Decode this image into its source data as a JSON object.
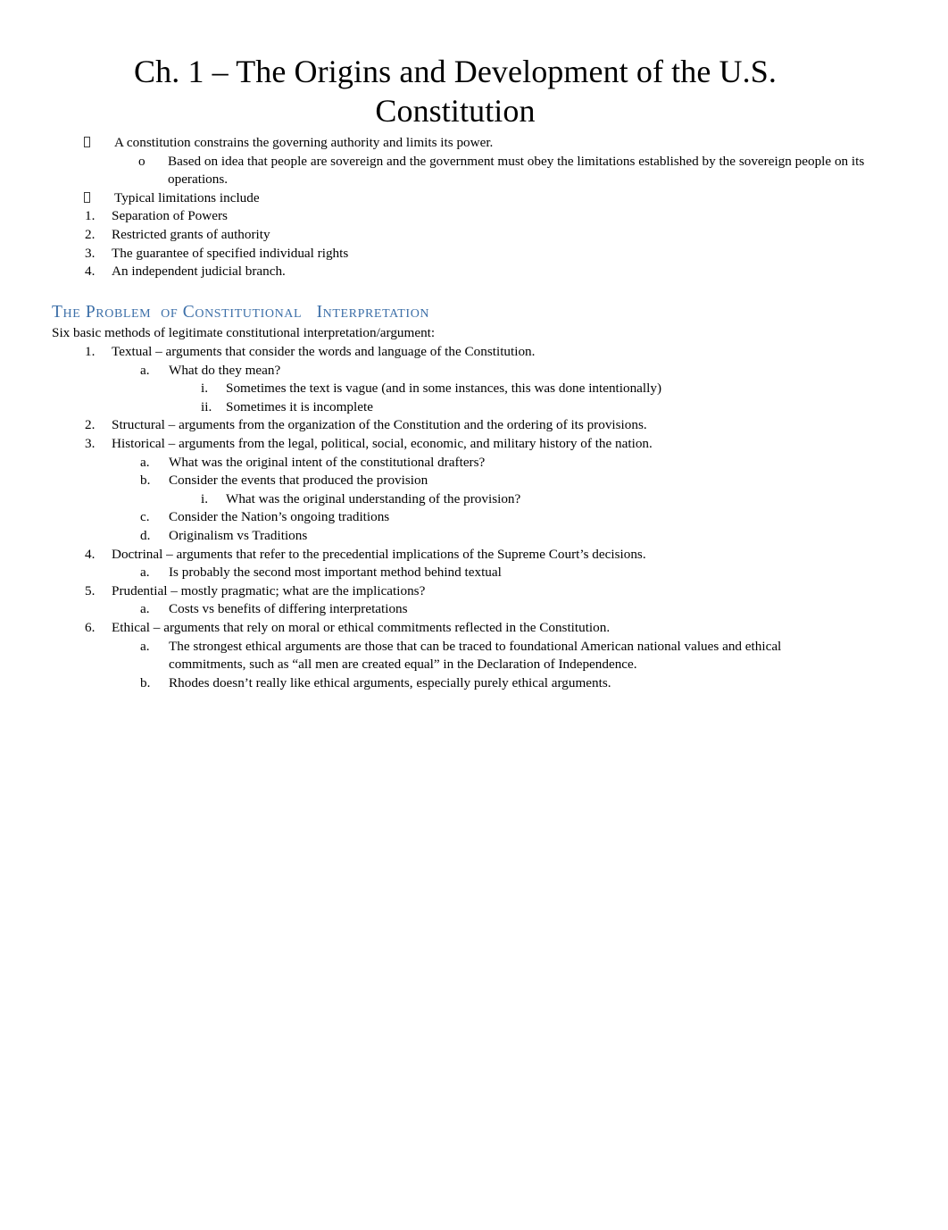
{
  "document": {
    "title_line_1": "Ch. 1 – The Origins and Development of the U.S.",
    "title_line_2": "Constitution"
  },
  "intro": {
    "items": [
      {
        "marker": "tofu",
        "level": "b1",
        "text": "A constitution constrains the governing authority and limits its power."
      },
      {
        "marker": "o",
        "level": "b2",
        "text": "Based on idea that people are sovereign and the government must obey the limitations established by the sovereign people on its operations."
      },
      {
        "marker": "tofu",
        "level": "b1",
        "text": "Typical limitations include"
      },
      {
        "marker": "1.",
        "level": "n1",
        "text": "Separation of Powers"
      },
      {
        "marker": "2.",
        "level": "n1",
        "text": "Restricted grants of authority"
      },
      {
        "marker": "3.",
        "level": "n1",
        "text": "The guarantee of specified individual rights"
      },
      {
        "marker": "4.",
        "level": "n1",
        "text": "An independent judicial branch."
      }
    ]
  },
  "section": {
    "heading": "The Problem  of Constitutional   Interpretation",
    "heading_color": "#3C6FA8",
    "lead": "Six basic methods of legitimate constitutional interpretation/argument:",
    "items": [
      {
        "marker": "1.",
        "level": "n1",
        "text": "Textual – arguments that consider the words and language of the Constitution."
      },
      {
        "marker": "a.",
        "level": "n2",
        "text": "What do they mean?"
      },
      {
        "marker": "i.",
        "level": "n3",
        "text": "Sometimes the text is vague (and in some instances, this was done intentionally)"
      },
      {
        "marker": "ii.",
        "level": "n3",
        "text": "Sometimes it is incomplete"
      },
      {
        "marker": "2.",
        "level": "n1",
        "text": "Structural – arguments from the organization of the Constitution and the ordering of its provisions."
      },
      {
        "marker": "3.",
        "level": "n1",
        "text": "Historical – arguments from the legal, political, social, economic, and military history of the nation."
      },
      {
        "marker": "a.",
        "level": "n2",
        "text": "What was the original intent of the constitutional drafters?"
      },
      {
        "marker": "b.",
        "level": "n2",
        "text": "Consider the events that produced the provision"
      },
      {
        "marker": "i.",
        "level": "n3",
        "text": "What was the original understanding of the provision?"
      },
      {
        "marker": "c.",
        "level": "n2",
        "text": "Consider the Nation’s ongoing traditions"
      },
      {
        "marker": "d.",
        "level": "n2",
        "text": "Originalism vs Traditions"
      },
      {
        "marker": "4.",
        "level": "n1",
        "text": "Doctrinal – arguments that refer to the   precedential  implications of the Supreme Court’s decisions."
      },
      {
        "marker": "a.",
        "level": "n2",
        "text": "Is probably the second most important method behind textual"
      },
      {
        "marker": "5.",
        "level": "n1",
        "text": "Prudential  – mostly pragmatic; what are the implications?"
      },
      {
        "marker": "a.",
        "level": "n2",
        "text": "Costs vs benefits of differing interpretations"
      },
      {
        "marker": "6.",
        "level": "n1",
        "text": "Ethical – arguments that rely on moral or ethical commitments reflected in the Constitution."
      },
      {
        "marker": "a.",
        "level": "n2",
        "text": "The strongest ethical arguments are those that can be traced to foundational American national values and ethical commitments, such as “all men are created equal” in the Declaration of Independence."
      },
      {
        "marker": "b.",
        "level": "n2",
        "text": "Rhodes doesn’t really like ethical arguments, especially purely ethical arguments."
      }
    ]
  }
}
